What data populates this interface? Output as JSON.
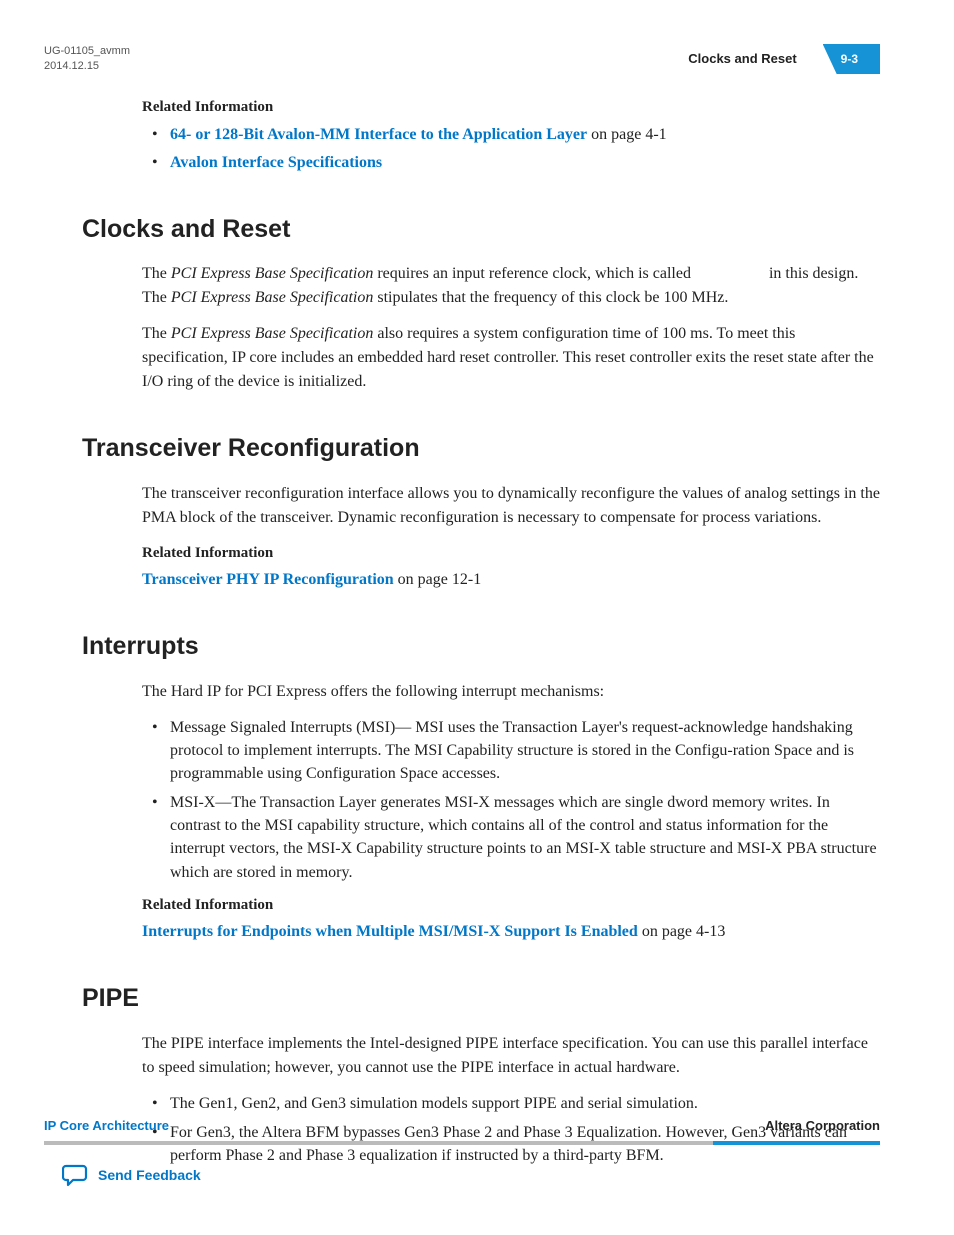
{
  "header": {
    "doc_id": "UG-01105_avmm",
    "date": "2014.12.15",
    "section_label": "Clocks and Reset",
    "page_num": "9-3"
  },
  "top_related": {
    "title": "Related Information",
    "items": [
      {
        "link": "64- or 128-Bit Avalon-MM Interface to the Application Layer",
        "suffix": " on page 4-1"
      },
      {
        "link": "Avalon Interface Specifications",
        "suffix": ""
      }
    ]
  },
  "clocks": {
    "heading": "Clocks and Reset",
    "p1_a": "The ",
    "p1_em1": "PCI Express Base Specification",
    "p1_b": " requires an input reference clock, which is called ",
    "p1_c": " in this design. The ",
    "p1_em2": "PCI Express Base Specification",
    "p1_d": " stipulates that the frequency of this clock be 100 MHz.",
    "p2_a": "The ",
    "p2_em": "PCI Express Base Specification",
    "p2_b": " also requires a system configuration time of 100 ms. To meet this specification, IP core includes an embedded hard reset controller. This reset controller exits the reset state after the I/O ring of the device is initialized."
  },
  "trans": {
    "heading": "Transceiver Reconfiguration",
    "p1": "The transceiver reconfiguration interface allows you to dynamically reconfigure the values of analog settings in the PMA block of the transceiver. Dynamic reconfiguration is necessary to compensate for process variations.",
    "rel_title": "Related Information",
    "link": "Transceiver PHY IP Reconfiguration",
    "link_suffix": " on page 12-1"
  },
  "interrupts": {
    "heading": "Interrupts",
    "intro": "The Hard IP for PCI Express offers the following interrupt mechanisms:",
    "li1": "Message Signaled Interrupts (MSI)— MSI uses the Transaction Layer's request‑acknowledge handshaking protocol to implement interrupts. The MSI Capability structure is stored in the Configu‐ration Space and is programmable using Configuration Space accesses.",
    "li2": "MSI-X—The Transaction Layer generates MSI-X messages which are single dword memory writes. In contrast to the MSI capability structure, which contains all of the control and status information for the interrupt vectors, the MSI‑X Capability structure points to an MSI‑X table structure and MSI‑X PBA structure which are stored in memory.",
    "rel_title": "Related Information",
    "link": "Interrupts for Endpoints when Multiple MSI/MSI‑X Support Is Enabled",
    "link_suffix": " on page 4-13"
  },
  "pipe": {
    "heading": "PIPE",
    "p1": "The PIPE interface implements the Intel‑designed PIPE interface specification. You can use this parallel interface to speed simulation; however, you cannot use the PIPE interface in actual hardware.",
    "li1": "The Gen1, Gen2, and Gen3 simulation models support PIPE and serial simulation.",
    "li2": "For Gen3, the Altera BFM bypasses Gen3 Phase 2 and Phase 3 Equalization. However, Gen3 variants can perform Phase 2 and Phase 3 equalization if instructed by a third-party BFM."
  },
  "footer": {
    "left": "IP Core Architecture",
    "right": "Altera Corporation",
    "feedback": "Send Feedback"
  }
}
